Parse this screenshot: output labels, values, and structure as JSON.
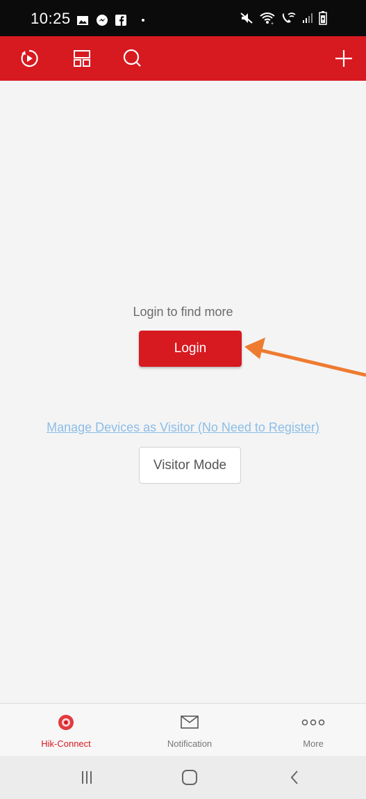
{
  "status_bar": {
    "time": "10:25",
    "left_icons": [
      "gallery-icon",
      "messenger-icon",
      "facebook-icon",
      "dot-icon"
    ],
    "right_icons": [
      "mute-icon",
      "wifi-icon",
      "wifi-calling-icon",
      "signal-icon",
      "battery-icon"
    ]
  },
  "toolbar": {
    "background": "#d71920",
    "icons": [
      "playback-icon",
      "layout-icon",
      "search-icon",
      "add-icon"
    ]
  },
  "main": {
    "login_prompt": "Login to find more",
    "login_button": "Login",
    "visitor_link": "Manage Devices as Visitor (No Need to Register)",
    "visitor_button": "Visitor Mode"
  },
  "annotation": {
    "arrow_color": "#ee7b30"
  },
  "tabs": [
    {
      "label": "Hik-Connect",
      "icon": "hik-connect-icon",
      "active": true
    },
    {
      "label": "Notification",
      "icon": "envelope-icon",
      "active": false
    },
    {
      "label": "More",
      "icon": "more-dots-icon",
      "active": false
    }
  ],
  "system_nav": {
    "buttons": [
      "recents-icon",
      "home-icon",
      "back-icon"
    ]
  }
}
